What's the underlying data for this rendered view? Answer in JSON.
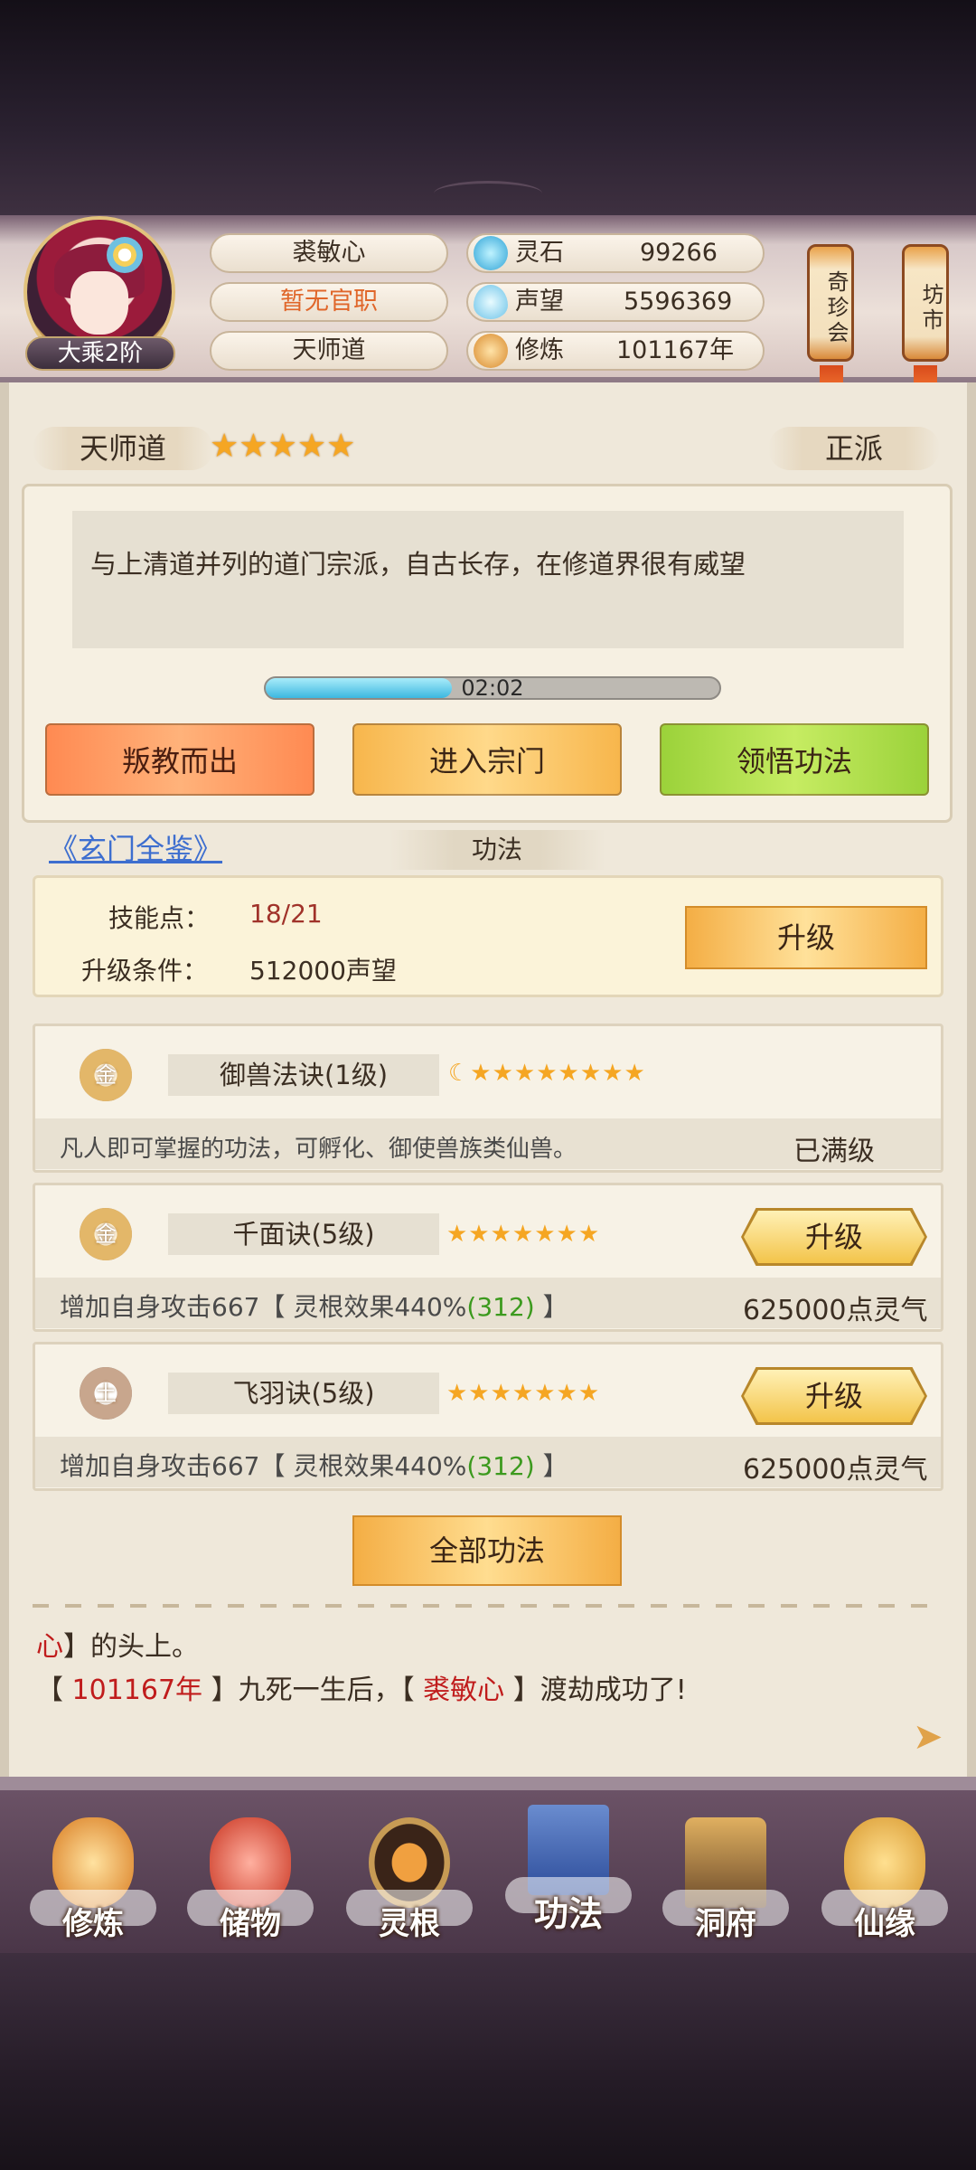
{
  "player": {
    "name": "裘敏心",
    "title": "暂无官职",
    "sect": "天师道",
    "realm": "大乘2阶"
  },
  "resources": [
    {
      "icon": "spirit-stone-icon",
      "label": "灵石",
      "value": "99266"
    },
    {
      "icon": "reputation-icon",
      "label": "声望",
      "value": "5596369"
    },
    {
      "icon": "cultivation-icon",
      "label": "修炼",
      "value": "101167年"
    }
  ],
  "side_buttons": {
    "treasure_fair": "奇珍会",
    "market": "坊市"
  },
  "sect_panel": {
    "name": "天师道",
    "stars": 5,
    "alignment": "正派",
    "description": "与上清道并列的道门宗派，自古长存，在修道界很有威望",
    "timer": "02:02",
    "timer_progress": 0.41,
    "buttons": {
      "betray": "叛教而出",
      "enter": "进入宗门",
      "comprehend": "领悟功法"
    }
  },
  "link_text": "《玄门全鉴》",
  "section_title": "功法",
  "skill_points": {
    "label": "技能点：",
    "value": "18/21",
    "condition_label": "升级条件：",
    "condition_value": "512000声望",
    "upgrade": "升级"
  },
  "skills": [
    {
      "badge": "金",
      "name": "御兽法诀(1级)",
      "stars": "☾★★★★★★★★",
      "desc": "凡人即可掌握的功法，可孵化、御使兽族类仙兽。",
      "status": "已满级"
    },
    {
      "badge": "金",
      "name": "千面诀(5级)",
      "stars": "★★★★★★★",
      "desc_prefix": "增加自身攻击667【 灵根效果440%",
      "desc_bonus": "(312)",
      "desc_suffix": " 】",
      "cost": "625000点灵气",
      "upgrade": "升级"
    },
    {
      "badge": "土",
      "name": "飞羽诀(5级)",
      "stars": "★★★★★★★",
      "desc_prefix": "增加自身攻击667【 灵根效果440%",
      "desc_bonus": "(312)",
      "desc_suffix": " 】",
      "cost": "625000点灵气",
      "upgrade": "升级"
    }
  ],
  "all_skills": "全部功法",
  "log": {
    "line1_red": "心",
    "line1_text": "】的头上。",
    "line2_open": "【",
    "line2_red": " 101167年",
    "line2_mid": " 】九死一生后，【",
    "line2_name": " 裘敏心",
    "line2_end": " 】渡劫成功了!"
  },
  "nav": [
    {
      "icon": "cultivation-monk-icon",
      "label": "修炼"
    },
    {
      "icon": "storage-bag-icon",
      "label": "储物"
    },
    {
      "icon": "spirit-root-icon",
      "label": "灵根"
    },
    {
      "icon": "skill-book-icon",
      "label": "功法"
    },
    {
      "icon": "cave-dwelling-icon",
      "label": "洞府"
    },
    {
      "icon": "immortal-fate-icon",
      "label": "仙缘"
    }
  ],
  "colors": {
    "accent_gold": "#f5a623",
    "title_orange": "#e0662a",
    "progress_blue": "#3cb7e0",
    "link_blue": "#3d6ecf",
    "bonus_green": "#3c9a1e",
    "log_red": "#c01c1c"
  }
}
